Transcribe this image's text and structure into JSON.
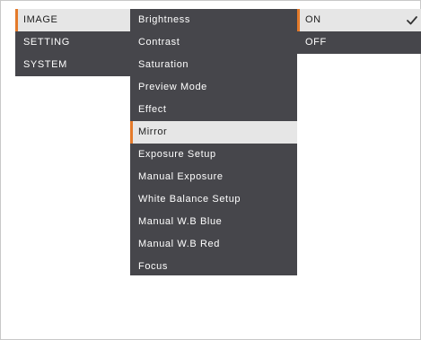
{
  "menu": {
    "level1": [
      {
        "label": "IMAGE",
        "selected": true
      },
      {
        "label": "SETTING",
        "selected": false
      },
      {
        "label": "SYSTEM",
        "selected": false
      }
    ],
    "level2": [
      {
        "label": "Brightness",
        "selected": false
      },
      {
        "label": "Contrast",
        "selected": false
      },
      {
        "label": "Saturation",
        "selected": false
      },
      {
        "label": "Preview Mode",
        "selected": false
      },
      {
        "label": "Effect",
        "selected": false
      },
      {
        "label": "Mirror",
        "selected": true
      },
      {
        "label": "Exposure Setup",
        "selected": false
      },
      {
        "label": "Manual Exposure",
        "selected": false
      },
      {
        "label": "White Balance Setup",
        "selected": false
      },
      {
        "label": "Manual W.B Blue",
        "selected": false
      },
      {
        "label": "Manual W.B Red",
        "selected": false
      },
      {
        "label": "Focus",
        "selected": false
      }
    ],
    "level3": [
      {
        "label": "ON",
        "selected": true,
        "checked": true
      },
      {
        "label": "OFF",
        "selected": false,
        "checked": false
      }
    ]
  },
  "icons": {
    "check": "checkmark-icon"
  },
  "colors": {
    "panel": "#46464b",
    "highlight": "#e6e6e6",
    "accent": "#e47a2a",
    "text": "#ffffff"
  }
}
